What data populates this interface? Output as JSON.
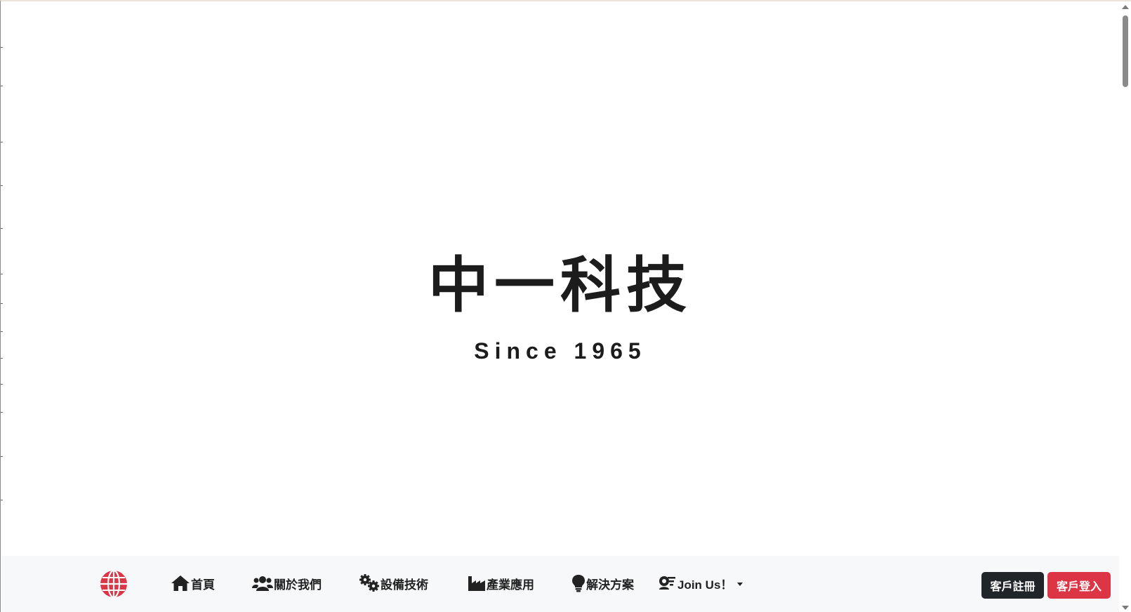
{
  "hero": {
    "title": "中一科技",
    "subtitle": "Since 1965"
  },
  "navbar": {
    "brand_icon": "globe-icon",
    "brand_color": "#dc3545",
    "items": [
      {
        "label": "首頁",
        "icon": "home-icon"
      },
      {
        "label": "關於我們",
        "icon": "users-icon"
      },
      {
        "label": "設備技術",
        "icon": "gears-icon"
      },
      {
        "label": "產業應用",
        "icon": "industry-icon"
      },
      {
        "label": "解決方案",
        "icon": "lightbulb-icon"
      },
      {
        "label": "Join Us！",
        "icon": "user-join-icon",
        "dropdown": true
      }
    ],
    "register_label": "客戶註冊",
    "login_label": "客戶登入",
    "register_color": "#212529",
    "login_color": "#dc3545"
  }
}
